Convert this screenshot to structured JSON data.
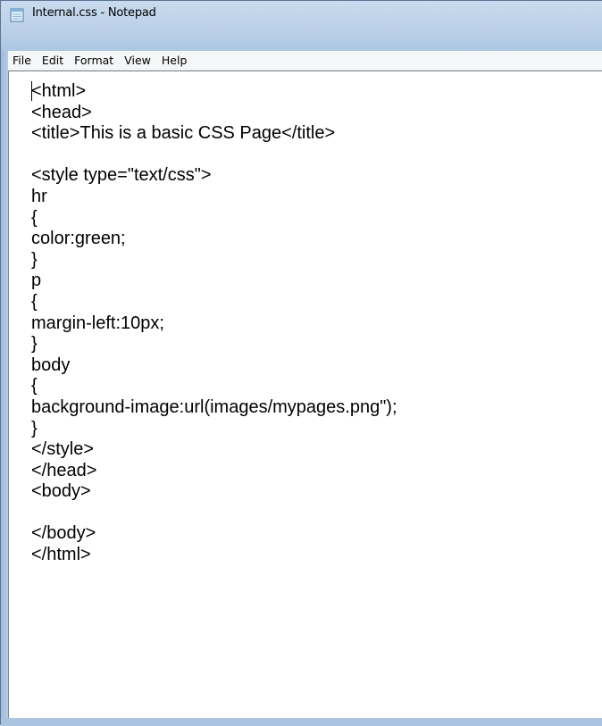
{
  "window": {
    "title": "Internal.css - Notepad",
    "app_icon": "notepad-icon"
  },
  "menubar": {
    "items": [
      {
        "label": "File"
      },
      {
        "label": "Edit"
      },
      {
        "label": "Format"
      },
      {
        "label": "View"
      },
      {
        "label": "Help"
      }
    ]
  },
  "editor": {
    "lines": [
      "<html>",
      "<head>",
      "<title>This is a basic CSS Page</title>",
      "",
      "<style type=\"text/css\">",
      "hr",
      "{",
      "color:green;",
      "}",
      "p",
      "{",
      "margin-left:10px;",
      "}",
      "body",
      "{",
      "background-image:url(images/mypages.png\");",
      "}",
      "</style>",
      "</head>",
      "<body>",
      "",
      "</body>",
      "</html>"
    ]
  }
}
